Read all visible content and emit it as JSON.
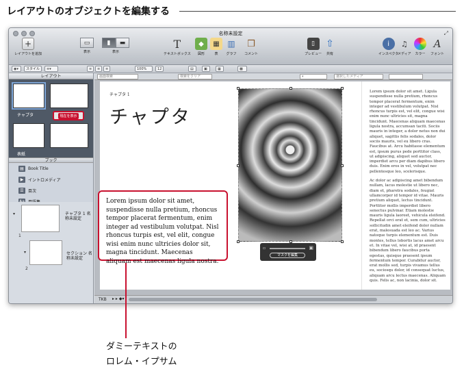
{
  "heading": "レイアウトのオブジェクトを編集する",
  "window": {
    "title": "名称未設定",
    "toolbar": [
      {
        "label": "レイアウトを追加",
        "icon": "plus-icon"
      },
      {
        "label": "表示",
        "icon": "view-icon"
      },
      {
        "label": "表示",
        "icon": "display-icon"
      },
      {
        "label": "テキストボックス",
        "icon": "textbox-icon"
      },
      {
        "label": "図形",
        "icon": "shape-icon"
      },
      {
        "label": "表",
        "icon": "table-icon"
      },
      {
        "label": "グラフ",
        "icon": "chart-icon"
      },
      {
        "label": "コメント",
        "icon": "comment-icon"
      },
      {
        "label": "プレビュー",
        "icon": "preview-icon"
      },
      {
        "label": "共有",
        "icon": "share-icon"
      },
      {
        "label": "インスペクタ",
        "icon": "inspector-icon"
      },
      {
        "label": "メディア",
        "icon": "media-icon"
      },
      {
        "label": "カラー",
        "icon": "color-icon"
      },
      {
        "label": "フォント",
        "icon": "font-icon"
      }
    ],
    "format_bar": {
      "zoom": "100%",
      "style": "スタイル",
      "font_size": "12"
    },
    "sidebar": {
      "layout_header": "レイアウト",
      "layouts": [
        {
          "label": "チャプタ"
        },
        {
          "label": "表紙"
        }
      ],
      "current_tag": "現在を表示",
      "book_header": "ブック",
      "book_items": [
        {
          "label": "Book Title"
        },
        {
          "label": "イントロメディア"
        },
        {
          "label": "目次"
        },
        {
          "label": "用語集"
        }
      ],
      "pages": [
        {
          "num": "1",
          "label": "チャプタ 1 名称未設定"
        },
        {
          "num": "2",
          "label": "セクション 名称未設定"
        }
      ]
    },
    "search_row": {
      "field_1": "画面検索",
      "field_2": "検索をクリア",
      "field_3": "選択したメディア"
    },
    "page": {
      "chapter_small": "チャプタ 1",
      "chapter_title": "チャプタ",
      "body_para_1": "Lorem ipsum dolor sit amet. Ligula suspendisse nulla pretium, rhoncus tempor placerat fermentum, enim integer ad vestibulum volutpat. Nisl rhoncus turpis est, vel elit, congue wisi enim nunc ultricies sit, magna tincidunt. Maecenas aliquam maecenas ligula nostra, accumsan taciti. Sociis mauris in integer, a dolor netus non dui aliquet, sagittis felis sodales, dolor sociis mauris, vel eu libero cras. Faucibus at. Arcu habitasse elementum est, ipsum purus pede porttitor class, ut adipiscing, aliquet sed auctor, imperdiet arcu per diam dapibus libero duis. Enim eros in vel, volutpat nec pellentesque leo, scelerisque.",
      "body_para_2": "Ac dolor ac adipiscing amet bibendum nullam, lacus molestie ut libero nec, diam et, pharetra sodales, feugiat ullamcorper id tempor id vitae. Mauris pretium aliquet, lectus tincidunt. Porttitor mollis imperdiet libero senectus pulvinar. Etiam molestie mauris ligula laoreet, vehicula eleifend. Repellat orci erat et, sem cum, ultricies sollicitudin amet eleifend dolor nullam erat, malesuada est leo ac. Varius natoque turpis elementum est. Duis montes, tellus lobortis lacus amet arcu et. In vitae vel, wisi at, id praesent bibendum libero faucibus porta egestas, quisque praesent ipsum fermentum tempor. Curabitur auctor, erat mollis sed, turpis vivamus tellus eu, sociosqu dolor, id consequat luctus, aliquam arcu lectus maecenas. Aliquam quis. Felis ac, non lacinia, dolor sit.",
      "mask_button": "マスクを編集"
    },
    "callout_text": "Lorem ipsum dolor sit amet, suspendisse nulla pretium, rhoncus tempor placerat fermentum, enim integer ad vestibulum volutpat. Nisl rhoncus turpis est, vel elit, congue wisi enim nunc ultricies dolor sit, magna tincidunt. Maecenas aliquam est maecenas ligula nostra.",
    "bottom_bar": "TKB"
  },
  "caption": {
    "line1": "ダミーテキストの",
    "line2": "ロレム・イプサム"
  }
}
